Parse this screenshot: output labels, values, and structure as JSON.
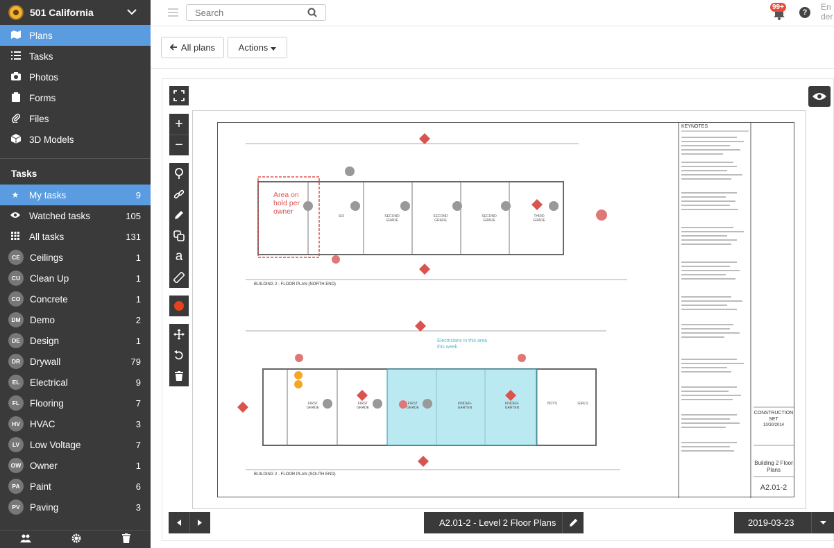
{
  "project": {
    "name": "501 California"
  },
  "nav": [
    {
      "label": "Plans",
      "icon": "map-icon",
      "active": true
    },
    {
      "label": "Tasks",
      "icon": "list-icon"
    },
    {
      "label": "Photos",
      "icon": "camera-icon"
    },
    {
      "label": "Forms",
      "icon": "clipboard-icon"
    },
    {
      "label": "Files",
      "icon": "paperclip-icon"
    },
    {
      "label": "3D Models",
      "icon": "cube-icon"
    }
  ],
  "tasks_section": {
    "title": "Tasks"
  },
  "task_filters": [
    {
      "label": "My tasks",
      "count": "9",
      "icon": "star-icon",
      "active": true
    },
    {
      "label": "Watched tasks",
      "count": "105",
      "icon": "eye-icon"
    },
    {
      "label": "All tasks",
      "count": "131",
      "icon": "grid-icon"
    }
  ],
  "categories": [
    {
      "abbr": "CE",
      "label": "Ceilings",
      "count": "1"
    },
    {
      "abbr": "CU",
      "label": "Clean Up",
      "count": "1"
    },
    {
      "abbr": "CO",
      "label": "Concrete",
      "count": "1"
    },
    {
      "abbr": "DM",
      "label": "Demo",
      "count": "2"
    },
    {
      "abbr": "DE",
      "label": "Design",
      "count": "1"
    },
    {
      "abbr": "DR",
      "label": "Drywall",
      "count": "79"
    },
    {
      "abbr": "EL",
      "label": "Electrical",
      "count": "9"
    },
    {
      "abbr": "FL",
      "label": "Flooring",
      "count": "7"
    },
    {
      "abbr": "HV",
      "label": "HVAC",
      "count": "3"
    },
    {
      "abbr": "LV",
      "label": "Low Voltage",
      "count": "7"
    },
    {
      "abbr": "OW",
      "label": "Owner",
      "count": "1"
    },
    {
      "abbr": "PA",
      "label": "Paint",
      "count": "6"
    },
    {
      "abbr": "PV",
      "label": "Paving",
      "count": "3"
    }
  ],
  "topbar": {
    "search_placeholder": "Search",
    "notification_count": "99+",
    "user_label": "En der"
  },
  "actions": {
    "all_plans": "All plans",
    "actions": "Actions"
  },
  "plan": {
    "sheet_name": "A2.01-2 - Level 2 Floor Plans",
    "date": "2019-03-23",
    "keynotes_title": "KEYNOTES",
    "title_north": "BUILDING 2 - FLOOR PLAN (NORTH END)",
    "title_south": "BUILDING 2 - FLOOR PLAN (SOUTH END)",
    "markup_note": "Area on hold per owner",
    "stamp": "CONSTRUCTION SET",
    "stamp_date": "10/30/2014",
    "sheet_title": "Building 2 Floor Plans",
    "sheet_number": "A2.01-2",
    "room_labels_north": [
      "SECOND GRADE",
      "SECOND GRADE",
      "SECOND GRADE",
      "THIRD GRADE",
      "SIX"
    ],
    "room_labels_south": [
      "FIRST GRADE",
      "FIRST GRADE",
      "FIRST GRADE",
      "KINDER- GARTEN",
      "KINDER- GARTEN",
      "BOYS",
      "GIRLS"
    ],
    "electrician_note": "Electricians in this area this week"
  },
  "colors": {
    "sidebar": "#3a3a3a",
    "accent": "#5b9be0",
    "highlight": "#9de0ec",
    "markup_red": "#d9534f",
    "pin_orange": "#f5a623"
  }
}
